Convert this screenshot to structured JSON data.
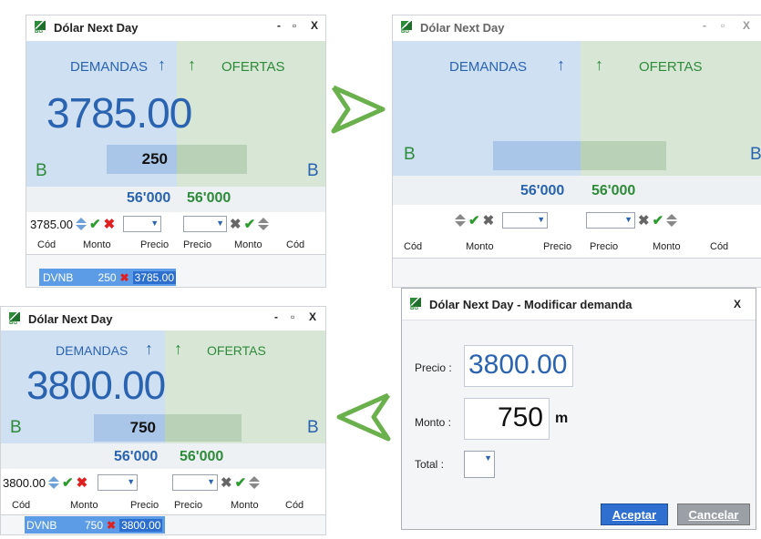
{
  "app": {
    "window_title": "Dólar Next Day",
    "minimize": "-",
    "maximize": "▫",
    "close": "X"
  },
  "labels": {
    "demandas": "DEMANDAS",
    "ofertas": "OFERTAS",
    "b": "B",
    "arrow_up": "↑"
  },
  "columns": {
    "cod": "Cód",
    "monto": "Monto",
    "precio": "Precio"
  },
  "stats": {
    "demand_total": "56'000",
    "offer_total": "56'000"
  },
  "panel1": {
    "price": "3785.00",
    "quantity": "250",
    "order_price_input": "3785.00",
    "order": {
      "symbol": "DVNB",
      "monto": "250",
      "precio": "3785.00"
    }
  },
  "panel2": {
    "price": "",
    "quantity": ""
  },
  "panel3": {
    "price": "3800.00",
    "quantity": "750",
    "order_price_input": "3800.00",
    "order": {
      "symbol": "DVNB",
      "monto": "750",
      "precio": "3800.00"
    }
  },
  "dialog": {
    "title": "Dólar Next Day - Modificar demanda",
    "close": "X",
    "precio_label": "Precio :",
    "precio_value": "3800.00",
    "monto_label": "Monto :",
    "monto_value": "750",
    "monto_unit": "m",
    "total_label": "Total :",
    "accept": "Aceptar",
    "cancel": "Cancelar"
  },
  "colors": {
    "demand_bg": "#cfe0f3",
    "offer_bg": "#d7e6d5",
    "demand_text": "#2a63b0",
    "offer_text": "#2e8b3a",
    "step_arrow": "#5cb85c"
  }
}
